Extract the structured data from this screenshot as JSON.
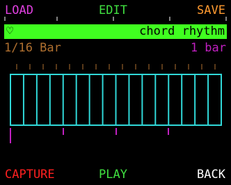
{
  "header": {
    "load_label": "LOAD",
    "edit_label": "EDIT",
    "save_label": "SAVE"
  },
  "pattern": {
    "favorite_icon": "heart-icon",
    "name": "chord rhythm",
    "resolution": "1/16 Bar",
    "length": "1 bar"
  },
  "grid": {
    "steps": 16
  },
  "footer": {
    "capture_label": "CAPTURE",
    "play_label": "PLAY",
    "back_label": "BACK"
  },
  "colors": {
    "load": "#e040e0",
    "edit": "#40e040",
    "save": "#ff9a30",
    "bar_bg": "#40ff20",
    "bar_text": "#000000",
    "resolution": "#b07030",
    "length": "#c020c0",
    "grid": "#30d8d8",
    "top_ticks": "#b07030",
    "bottom_ticks": "#c020c0",
    "capture": "#ff2020",
    "play": "#40e040",
    "back": "#ffffff",
    "header_ticks": "#ffffff"
  }
}
